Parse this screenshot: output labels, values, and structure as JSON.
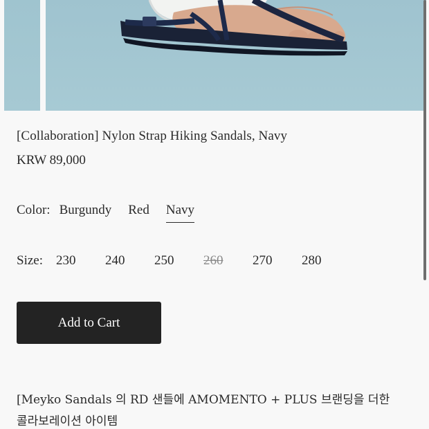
{
  "product": {
    "title": "[Collaboration] Nylon Strap Hiking Sandals, Navy",
    "price": "KRW 89,000"
  },
  "color": {
    "label": "Color:",
    "options": [
      "Burgundy",
      "Red",
      "Navy"
    ],
    "selected": "Navy"
  },
  "size": {
    "label": "Size:",
    "options": [
      "230",
      "240",
      "250",
      "260",
      "270",
      "280"
    ],
    "unavailable": [
      "260"
    ]
  },
  "cart": {
    "label": "Add to Cart"
  },
  "description": {
    "line1": "[Meyko Sandals 의 RD 샌들에 AMOMENTO + PLUS 브랜딩을 더한",
    "line2": "콜라보레이션 아이템"
  },
  "colors": {
    "photo_bg": "#a3c7d1",
    "button_bg": "#232323",
    "text": "#2a2a2a",
    "page_bg": "#f8f8f8"
  }
}
